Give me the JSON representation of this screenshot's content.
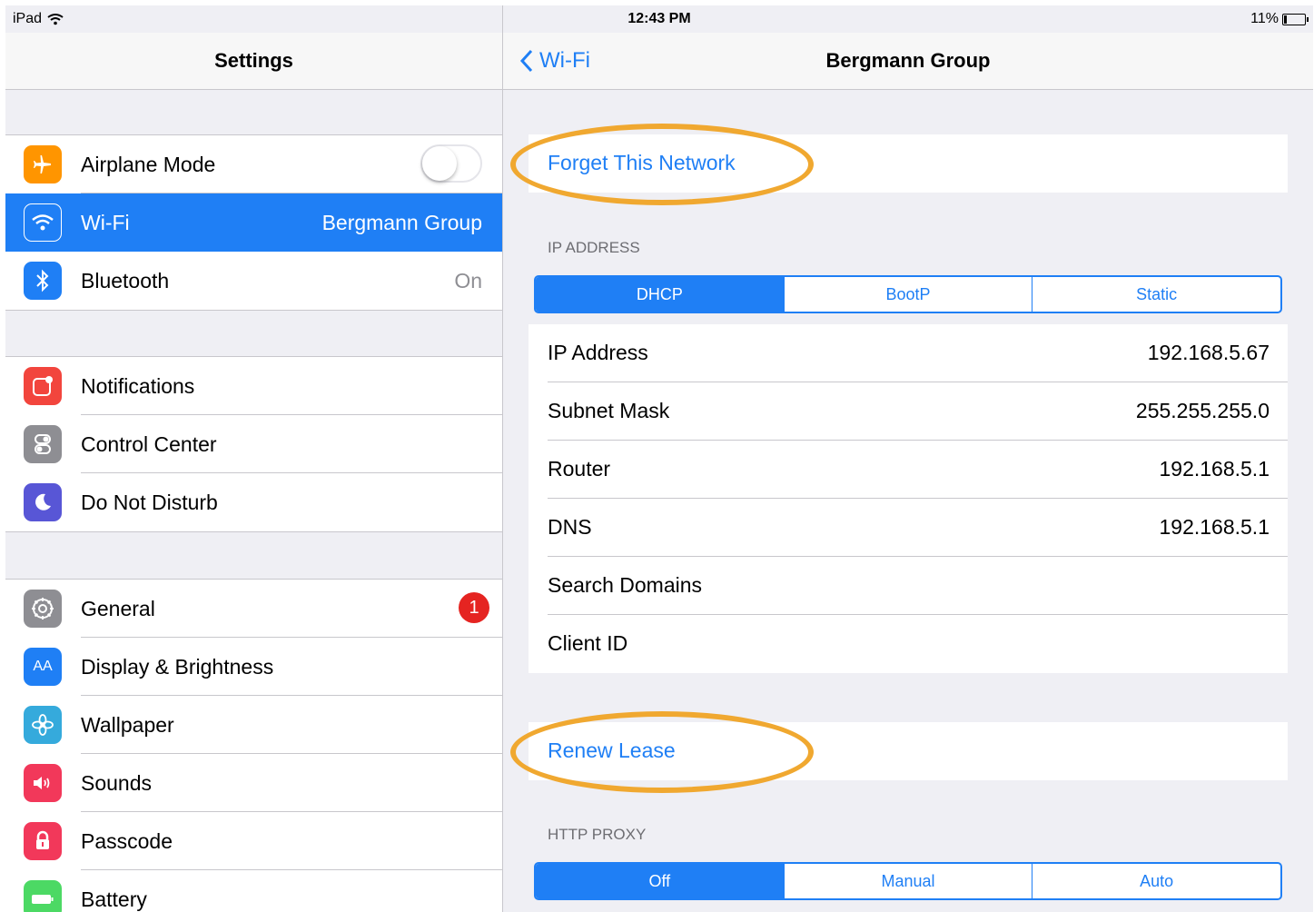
{
  "status_bar": {
    "device": "iPad",
    "time": "12:43 PM",
    "battery": "11%"
  },
  "left": {
    "title": "Settings",
    "group1": [
      {
        "label": "Airplane Mode",
        "icon": "airplane-icon",
        "color": "#ff9500",
        "toggle": false
      },
      {
        "label": "Wi-Fi",
        "value": "Bergmann Group",
        "icon": "wifi-icon",
        "color": "#1f7ff5"
      },
      {
        "label": "Bluetooth",
        "value": "On",
        "icon": "bluetooth-icon",
        "color": "#1f7ff5"
      }
    ],
    "group2": [
      {
        "label": "Notifications",
        "icon": "notifications-icon",
        "color": "#f2453d"
      },
      {
        "label": "Control Center",
        "icon": "control-center-icon",
        "color": "#8e8e93"
      },
      {
        "label": "Do Not Disturb",
        "icon": "moon-icon",
        "color": "#5856d6"
      }
    ],
    "group3": [
      {
        "label": "General",
        "badge": "1",
        "icon": "gear-icon",
        "color": "#8e8e93"
      },
      {
        "label": "Display & Brightness",
        "icon": "display-icon",
        "color": "#1f7ff5",
        "glyph": "AA"
      },
      {
        "label": "Wallpaper",
        "icon": "wallpaper-icon",
        "color": "#35aadc"
      },
      {
        "label": "Sounds",
        "icon": "sounds-icon",
        "color": "#f2385a"
      },
      {
        "label": "Passcode",
        "icon": "lock-icon",
        "color": "#f2385a"
      },
      {
        "label": "Battery",
        "icon": "battery-icon",
        "color": "#4cd964"
      }
    ]
  },
  "right": {
    "back_label": "Wi-Fi",
    "title": "Bergmann Group",
    "forget_label": "Forget This Network",
    "ip_section": "IP ADDRESS",
    "ip_segments": [
      "DHCP",
      "BootP",
      "Static"
    ],
    "ip_rows": [
      {
        "k": "IP Address",
        "v": "192.168.5.67"
      },
      {
        "k": "Subnet Mask",
        "v": "255.255.255.0"
      },
      {
        "k": "Router",
        "v": "192.168.5.1"
      },
      {
        "k": "DNS",
        "v": "192.168.5.1"
      },
      {
        "k": "Search Domains",
        "v": ""
      },
      {
        "k": "Client ID",
        "v": ""
      }
    ],
    "renew_label": "Renew Lease",
    "proxy_section": "HTTP PROXY",
    "proxy_segments": [
      "Off",
      "Manual",
      "Auto"
    ]
  },
  "colors": {
    "accent": "#1f7ff5",
    "highlight": "#f0a830"
  }
}
